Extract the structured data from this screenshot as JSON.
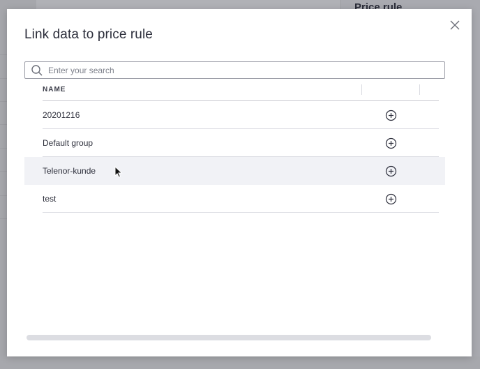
{
  "background": {
    "right_panel_title": "Price rule"
  },
  "modal": {
    "title": "Link data to price rule",
    "close_icon": "close-icon",
    "search": {
      "placeholder": "Enter your search",
      "value": "",
      "icon": "search-icon"
    },
    "table": {
      "columns": [
        "NAME",
        ""
      ],
      "rows": [
        {
          "name": "20201216",
          "action_icon": "add-circle-icon"
        },
        {
          "name": "Default group",
          "action_icon": "add-circle-icon"
        },
        {
          "name": "Telenor-kunde",
          "action_icon": "add-circle-icon",
          "hovered": true
        },
        {
          "name": "test",
          "action_icon": "add-circle-icon"
        }
      ]
    }
  },
  "colors": {
    "title_text": "#2b2d3a",
    "hover_row": "#f1f2f6",
    "overlay": "#a9aab0"
  }
}
